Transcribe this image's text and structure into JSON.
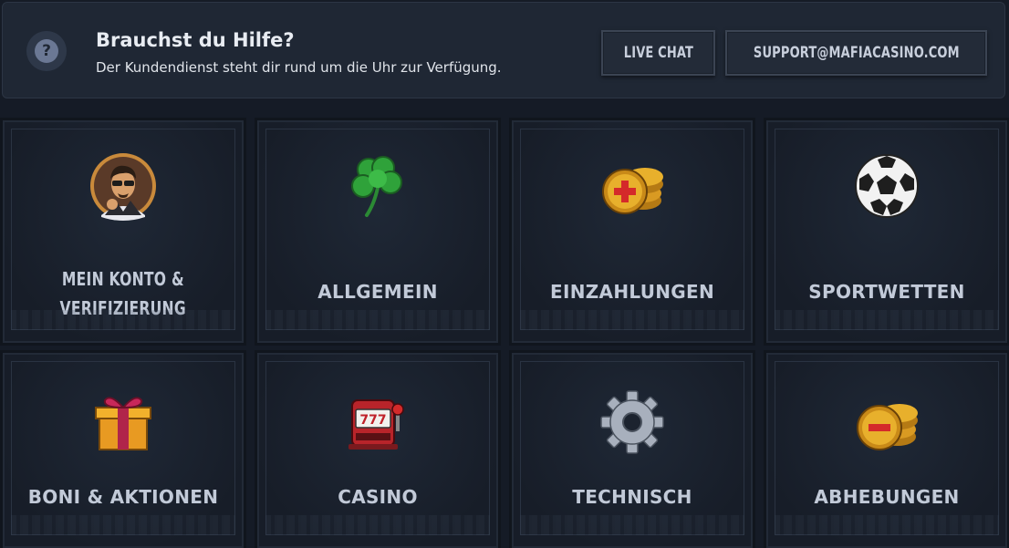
{
  "help": {
    "title": "Brauchst du Hilfe?",
    "subtitle": "Der Kundendienst steht dir rund um die Uhr zur Verfügung.",
    "icon": "question-icon",
    "live_chat_label": "LIVE CHAT",
    "email_label": "SUPPORT@MAFIACASINO.COM"
  },
  "categories": [
    {
      "label_line1": "MEIN KONTO &",
      "label_line2": "VERIFIZIERUNG",
      "icon": "mafioso-avatar-icon"
    },
    {
      "label": "ALLGEMEIN",
      "icon": "clover-icon"
    },
    {
      "label": "EINZAHLUNGEN",
      "icon": "coins-plus-icon"
    },
    {
      "label": "SPORTWETTEN",
      "icon": "soccer-ball-icon"
    },
    {
      "label": "BONI & AKTIONEN",
      "icon": "gift-box-icon"
    },
    {
      "label": "CASINO",
      "icon": "slot-machine-icon"
    },
    {
      "label": "TECHNISCH",
      "icon": "gear-icon"
    },
    {
      "label": "ABHEBUNGEN",
      "icon": "coins-minus-icon"
    }
  ],
  "colors": {
    "background": "#151b26",
    "panel": "#1f2734",
    "label": "#c2cad8",
    "gold": "#e8b02c",
    "red": "#d42a2a",
    "clover": "#2fa23a"
  }
}
